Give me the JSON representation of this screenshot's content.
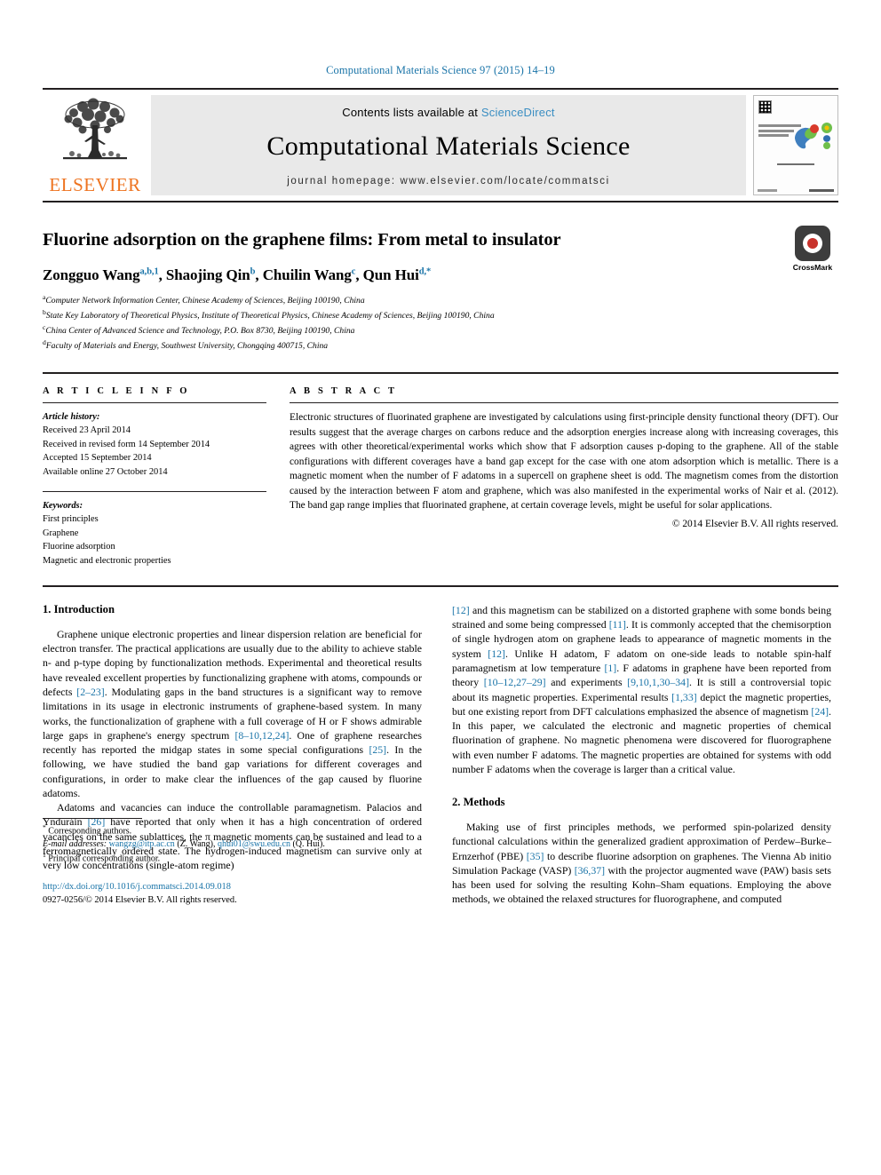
{
  "running_head": "Computational Materials Science 97 (2015) 14–19",
  "masthead": {
    "publisher_wordmark": "ELSEVIER",
    "contents_prefix": "Contents lists available at ",
    "contents_link": "ScienceDirect",
    "journal_title": "Computational Materials Science",
    "homepage": "journal homepage: www.elsevier.com/locate/commatsci",
    "cover_title_alt": "COMPUTATIONAL MATERIALS SCIENCE"
  },
  "crossmark": {
    "label": "CrossMark"
  },
  "article": {
    "title": "Fluorine adsorption on the graphene films: From metal to insulator",
    "authors": [
      {
        "name": "Zongguo Wang",
        "marks": "a,b,1"
      },
      {
        "name": "Shaojing Qin",
        "marks": "b"
      },
      {
        "name": "Chuilin Wang",
        "marks": "c"
      },
      {
        "name": "Qun Hui",
        "marks": "d,*"
      }
    ],
    "affiliations": [
      {
        "mark": "a",
        "text": "Computer Network Information Center, Chinese Academy of Sciences, Beijing 100190, China"
      },
      {
        "mark": "b",
        "text": "State Key Laboratory of Theoretical Physics, Institute of Theoretical Physics, Chinese Academy of Sciences, Beijing 100190, China"
      },
      {
        "mark": "c",
        "text": "China Center of Advanced Science and Technology, P.O. Box 8730, Beijing 100190, China"
      },
      {
        "mark": "d",
        "text": "Faculty of Materials and Energy, Southwest University, Chongqing 400715, China"
      }
    ]
  },
  "article_info": {
    "heading": "A R T I C L E   I N F O",
    "history_label": "Article history:",
    "history": [
      "Received 23 April 2014",
      "Received in revised form 14 September 2014",
      "Accepted 15 September 2014",
      "Available online 27 October 2014"
    ],
    "keywords_label": "Keywords:",
    "keywords": [
      "First principles",
      "Graphene",
      "Fluorine adsorption",
      "Magnetic and electronic properties"
    ]
  },
  "abstract": {
    "heading": "A B S T R A C T",
    "text": "Electronic structures of fluorinated graphene are investigated by calculations using first-principle density functional theory (DFT). Our results suggest that the average charges on carbons reduce and the adsorption energies increase along with increasing coverages, this agrees with other theoretical/experimental works which show that F adsorption causes p-doping to the graphene. All of the stable configurations with different coverages have a band gap except for the case with one atom adsorption which is metallic. There is a magnetic moment when the number of F adatoms in a supercell on graphene sheet is odd. The magnetism comes from the distortion caused by the interaction between F atom and graphene, which was also manifested in the experimental works of Nair et al. (2012). The band gap range implies that fluorinated graphene, at certain coverage levels, might be useful for solar applications.",
    "copyright": "© 2014 Elsevier B.V. All rights reserved."
  },
  "sections": {
    "introduction_heading": "1. Introduction",
    "methods_heading": "2. Methods",
    "intro_p1_a": "Graphene unique electronic properties and linear dispersion relation are beneficial for electron transfer. The practical applications are usually due to the ability to achieve stable n- and p-type doping by functionalization methods. Experimental and theoretical results have revealed excellent properties by functionalizing graphene with atoms, compounds or defects ",
    "intro_p1_ref1": "[2–23]",
    "intro_p1_b": ". Modulating gaps in the band structures is a significant way to remove limitations in its usage in electronic instruments of graphene-based system. In many works, the functionalization of graphene with a full coverage of H or F shows admirable large gaps in graphene's energy spectrum ",
    "intro_p1_ref2": "[8–10,12,24]",
    "intro_p1_c": ". One of graphene researches recently has reported the midgap states in some special configurations ",
    "intro_p1_ref3": "[25]",
    "intro_p1_d": ". In the following, we have studied the band gap variations for different coverages and configurations, in order to make clear the influences of the gap caused by fluorine adatoms.",
    "intro_p2_a": "Adatoms and vacancies can induce the controllable paramagnetism. Palacios and Ynduráin ",
    "intro_p2_ref1": "[26]",
    "intro_p2_b": " have reported that only when it has a high concentration of ordered vacancies on the same sublattices, the π magnetic moments can be sustained and lead to a ferromagnetically ordered state. The hydrogen-induced magnetism can survive only at very low concentrations (single-atom regime)",
    "intro_p2_ref2": "[12]",
    "intro_p2_c": " and this magnetism can be stabilized on a distorted graphene with some bonds being strained and some being compressed ",
    "intro_p2_ref3": "[11]",
    "intro_p2_d": ". It is commonly accepted that the chemisorption of single hydrogen atom on graphene leads to appearance of magnetic moments in the system ",
    "intro_p2_ref4": "[12]",
    "intro_p2_e": ". Unlike H adatom, F adatom on one-side leads to notable spin-half paramagnetism at low temperature ",
    "intro_p2_ref5": "[1]",
    "intro_p2_f": ". F adatoms in graphene have been reported from theory ",
    "intro_p2_ref6": "[10–12,27–29]",
    "intro_p2_g": " and experiments ",
    "intro_p2_ref7": "[9,10,1,30–34]",
    "intro_p2_h": ". It is still a controversial topic about its magnetic properties. Experimental results ",
    "intro_p2_ref8": "[1,33]",
    "intro_p2_i": " depict the magnetic properties, but one existing report from DFT calculations emphasized the absence of magnetism ",
    "intro_p2_ref9": "[24]",
    "intro_p2_j": ". In this paper, we calculated the electronic and magnetic properties of chemical fluorination of graphene. No magnetic phenomena were discovered for fluorographene with even number F adatoms. The magnetic properties are obtained for systems with odd number F adatoms when the coverage is larger than a critical value.",
    "methods_p1_a": "Making use of first principles methods, we performed spin-polarized density functional calculations within the generalized gradient approximation of Perdew–Burke–Ernzerhof (PBE) ",
    "methods_p1_ref1": "[35]",
    "methods_p1_b": " to describe fluorine adsorption on graphenes. The Vienna Ab initio Simulation Package (VASP) ",
    "methods_p1_ref2": "[36,37]",
    "methods_p1_c": " with the projector augmented wave (PAW) basis sets has been used for solving the resulting Kohn–Sham equations. Employing the above methods, we obtained the relaxed structures for fluorographene, and computed"
  },
  "footnotes": {
    "corresponding": "Corresponding authors.",
    "email_label": "E-mail addresses:",
    "email1": "wangzg@itp.ac.cn",
    "email1_owner": "(Z. Wang),",
    "email2": "qhui01@swu.edu.cn",
    "email2_owner": "(Q. Hui).",
    "principal": "Principal corresponding author.",
    "doi": "http://dx.doi.org/10.1016/j.commatsci.2014.09.018",
    "issn_line": "0927-0256/© 2014 Elsevier B.V. All rights reserved."
  },
  "colors": {
    "link_blue": "#1a74a8",
    "elsevier_orange": "#ee7421",
    "band_gray": "#e9e9e9"
  }
}
